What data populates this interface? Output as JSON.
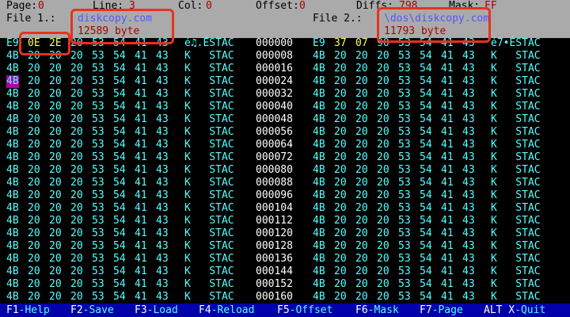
{
  "status": {
    "page_label": "Page:",
    "page": "0",
    "line_label": "Line:",
    "line": "3",
    "col_label": "Col:",
    "col": "0",
    "offset_label": "Offset:",
    "offset": "0",
    "diffs_label": "Diffs:",
    "diffs": "798",
    "mask_label": "Mask:",
    "mask": "FF"
  },
  "file1": {
    "label": "File 1.:",
    "name": "diskcopy.com",
    "size": "12589 byte"
  },
  "file2": {
    "label": "File 2.:",
    "name": "\\dos\\diskcopy.com",
    "size": "11793 byte"
  },
  "rows": [
    {
      "left": [
        "E9",
        "0E",
        "2E",
        "20",
        "53",
        "54",
        "41",
        "43"
      ],
      "left_ascii": "é♫.ÉSTAC",
      "offset": "000000",
      "right": [
        "E9",
        "37",
        "07",
        "90",
        "53",
        "54",
        "41",
        "43"
      ],
      "right_ascii": "é7•ÉSTAC"
    },
    {
      "left": [
        "4B",
        "20",
        "20",
        "20",
        "53",
        "54",
        "41",
        "43"
      ],
      "left_ascii": "K   STAC",
      "offset": "000008",
      "right": [
        "4B",
        "20",
        "20",
        "20",
        "53",
        "54",
        "41",
        "43"
      ],
      "right_ascii": "K   STAC"
    },
    {
      "left": [
        "4B",
        "20",
        "20",
        "20",
        "53",
        "54",
        "41",
        "43"
      ],
      "left_ascii": "K   STAC",
      "offset": "000016",
      "right": [
        "4B",
        "20",
        "20",
        "20",
        "53",
        "54",
        "41",
        "43"
      ],
      "right_ascii": "K   STAC"
    },
    {
      "left": [
        "4B",
        "20",
        "20",
        "20",
        "53",
        "54",
        "41",
        "43"
      ],
      "left_ascii": "K   STAC",
      "offset": "000024",
      "right": [
        "4B",
        "20",
        "20",
        "20",
        "53",
        "54",
        "41",
        "43"
      ],
      "right_ascii": "K   STAC"
    },
    {
      "left": [
        "4B",
        "20",
        "20",
        "20",
        "53",
        "54",
        "41",
        "43"
      ],
      "left_ascii": "K   STAC",
      "offset": "000032",
      "right": [
        "4B",
        "20",
        "20",
        "20",
        "53",
        "54",
        "41",
        "43"
      ],
      "right_ascii": "K   STAC"
    },
    {
      "left": [
        "4B",
        "20",
        "20",
        "20",
        "53",
        "54",
        "41",
        "43"
      ],
      "left_ascii": "K   STAC",
      "offset": "000040",
      "right": [
        "4B",
        "20",
        "20",
        "20",
        "53",
        "54",
        "41",
        "43"
      ],
      "right_ascii": "K   STAC"
    },
    {
      "left": [
        "4B",
        "20",
        "20",
        "20",
        "53",
        "54",
        "41",
        "43"
      ],
      "left_ascii": "K   STAC",
      "offset": "000048",
      "right": [
        "4B",
        "20",
        "20",
        "20",
        "53",
        "54",
        "41",
        "43"
      ],
      "right_ascii": "K   STAC"
    },
    {
      "left": [
        "4B",
        "20",
        "20",
        "20",
        "53",
        "54",
        "41",
        "43"
      ],
      "left_ascii": "K   STAC",
      "offset": "000056",
      "right": [
        "4B",
        "20",
        "20",
        "20",
        "53",
        "54",
        "41",
        "43"
      ],
      "right_ascii": "K   STAC"
    },
    {
      "left": [
        "4B",
        "20",
        "20",
        "20",
        "53",
        "54",
        "41",
        "43"
      ],
      "left_ascii": "K   STAC",
      "offset": "000064",
      "right": [
        "4B",
        "20",
        "20",
        "20",
        "53",
        "54",
        "41",
        "43"
      ],
      "right_ascii": "K   STAC"
    },
    {
      "left": [
        "4B",
        "20",
        "20",
        "20",
        "53",
        "54",
        "41",
        "43"
      ],
      "left_ascii": "K   STAC",
      "offset": "000072",
      "right": [
        "4B",
        "20",
        "20",
        "20",
        "53",
        "54",
        "41",
        "43"
      ],
      "right_ascii": "K   STAC"
    },
    {
      "left": [
        "4B",
        "20",
        "20",
        "20",
        "53",
        "54",
        "41",
        "43"
      ],
      "left_ascii": "K   STAC",
      "offset": "000080",
      "right": [
        "4B",
        "20",
        "20",
        "20",
        "53",
        "54",
        "41",
        "43"
      ],
      "right_ascii": "K   STAC"
    },
    {
      "left": [
        "4B",
        "20",
        "20",
        "20",
        "53",
        "54",
        "41",
        "43"
      ],
      "left_ascii": "K   STAC",
      "offset": "000088",
      "right": [
        "4B",
        "20",
        "20",
        "20",
        "53",
        "54",
        "41",
        "43"
      ],
      "right_ascii": "K   STAC"
    },
    {
      "left": [
        "4B",
        "20",
        "20",
        "20",
        "53",
        "54",
        "41",
        "43"
      ],
      "left_ascii": "K   STAC",
      "offset": "000096",
      "right": [
        "4B",
        "20",
        "20",
        "20",
        "53",
        "54",
        "41",
        "43"
      ],
      "right_ascii": "K   STAC"
    },
    {
      "left": [
        "4B",
        "20",
        "20",
        "20",
        "53",
        "54",
        "41",
        "43"
      ],
      "left_ascii": "K   STAC",
      "offset": "000104",
      "right": [
        "4B",
        "20",
        "20",
        "20",
        "53",
        "54",
        "41",
        "43"
      ],
      "right_ascii": "K   STAC"
    },
    {
      "left": [
        "4B",
        "20",
        "20",
        "20",
        "53",
        "54",
        "41",
        "43"
      ],
      "left_ascii": "K   STAC",
      "offset": "000112",
      "right": [
        "4B",
        "20",
        "20",
        "20",
        "53",
        "54",
        "41",
        "43"
      ],
      "right_ascii": "K   STAC"
    },
    {
      "left": [
        "4B",
        "20",
        "20",
        "20",
        "53",
        "54",
        "41",
        "43"
      ],
      "left_ascii": "K   STAC",
      "offset": "000120",
      "right": [
        "4B",
        "20",
        "20",
        "20",
        "53",
        "54",
        "41",
        "43"
      ],
      "right_ascii": "K   STAC"
    },
    {
      "left": [
        "4B",
        "20",
        "20",
        "20",
        "53",
        "54",
        "41",
        "43"
      ],
      "left_ascii": "K   STAC",
      "offset": "000128",
      "right": [
        "4B",
        "20",
        "20",
        "20",
        "53",
        "54",
        "41",
        "43"
      ],
      "right_ascii": "K   STAC"
    },
    {
      "left": [
        "4B",
        "20",
        "20",
        "20",
        "53",
        "54",
        "41",
        "43"
      ],
      "left_ascii": "K   STAC",
      "offset": "000136",
      "right": [
        "4B",
        "20",
        "20",
        "20",
        "53",
        "54",
        "41",
        "43"
      ],
      "right_ascii": "K   STAC"
    },
    {
      "left": [
        "4B",
        "20",
        "20",
        "20",
        "53",
        "54",
        "41",
        "43"
      ],
      "left_ascii": "K   STAC",
      "offset": "000144",
      "right": [
        "4B",
        "20",
        "20",
        "20",
        "53",
        "54",
        "41",
        "43"
      ],
      "right_ascii": "K   STAC"
    },
    {
      "left": [
        "4B",
        "20",
        "20",
        "20",
        "53",
        "54",
        "41",
        "43"
      ],
      "left_ascii": "K   STAC",
      "offset": "000152",
      "right": [
        "4B",
        "20",
        "20",
        "20",
        "53",
        "54",
        "41",
        "43"
      ],
      "right_ascii": "K   STAC"
    },
    {
      "left": [
        "4B",
        "20",
        "20",
        "20",
        "53",
        "54",
        "41",
        "43"
      ],
      "left_ascii": "K   STAC",
      "offset": "000160",
      "right": [
        "4B",
        "20",
        "20",
        "20",
        "53",
        "54",
        "41",
        "43"
      ],
      "right_ascii": "K   STAC"
    }
  ],
  "function_keys": [
    {
      "key": "F1",
      "label": "-Help"
    },
    {
      "key": "F2",
      "label": "-Save"
    },
    {
      "key": "F3",
      "label": "-Load"
    },
    {
      "key": "F4",
      "label": "-Reload"
    },
    {
      "key": "F5",
      "label": "-Offset"
    },
    {
      "key": "F6",
      "label": "-Mask"
    },
    {
      "key": "F7",
      "label": "-Page"
    },
    {
      "key": "ALT X",
      "label": "-Quit"
    }
  ],
  "colors": {
    "header_bg": "#aaaaaa",
    "value_red": "#aa0000",
    "filename_blue": "#5555ff",
    "hex_cyan": "#55ffff",
    "changed_byte_yellow": "#ffff55",
    "cursor_magenta": "#aa00aa",
    "function_bar_bg": "#0000aa",
    "annotation_box_red": "#e8321e"
  }
}
